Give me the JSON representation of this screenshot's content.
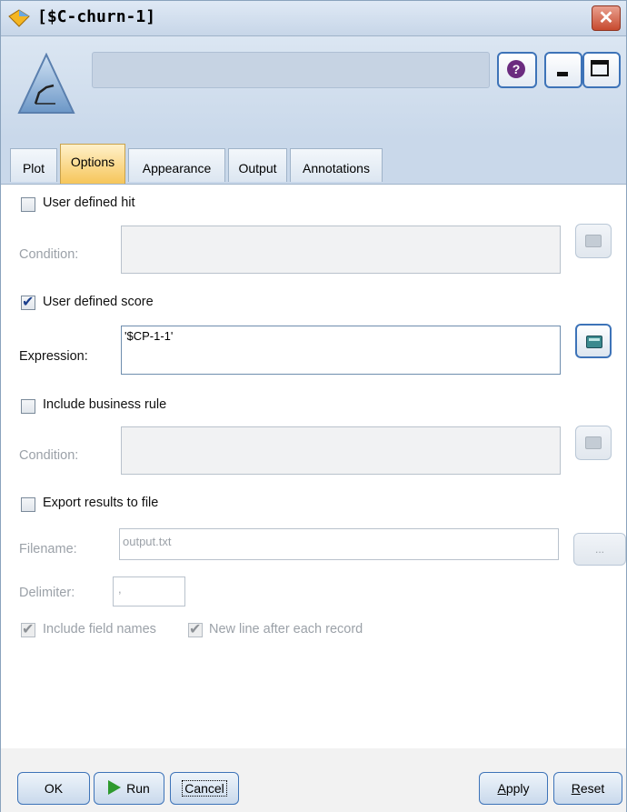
{
  "window": {
    "title": "[$C-churn-1]"
  },
  "header": {
    "node_name": ""
  },
  "tabs": [
    {
      "label": "Plot",
      "active": false
    },
    {
      "label": "Options",
      "active": true
    },
    {
      "label": "Appearance",
      "active": false
    },
    {
      "label": "Output",
      "active": false
    },
    {
      "label": "Annotations",
      "active": false
    }
  ],
  "options": {
    "user_defined_hit": {
      "label": "User defined hit",
      "checked": false,
      "condition_label": "Condition:",
      "condition_value": ""
    },
    "user_defined_score": {
      "label": "User defined score",
      "checked": true,
      "expression_label": "Expression:",
      "expression_value": "'$CP-1-1'"
    },
    "include_business_rule": {
      "label": "Include business rule",
      "checked": false,
      "condition_label": "Condition:",
      "condition_value": ""
    },
    "export_results": {
      "label": "Export results to file",
      "checked": false,
      "filename_label": "Filename:",
      "filename_value": "output.txt",
      "browse_label": "...",
      "delimiter_label": "Delimiter:",
      "delimiter_value": ",",
      "include_field_names": {
        "label": "Include field names",
        "checked": true
      },
      "new_line_after_record": {
        "label": "New line after each record",
        "checked": true
      }
    }
  },
  "footer": {
    "ok": "OK",
    "run": "Run",
    "cancel": "Cancel",
    "apply_u": "A",
    "apply_rest": "pply",
    "reset_u": "R",
    "reset_rest": "eset"
  },
  "colors": {
    "accent": "#3d73b8",
    "active_tab": "#f6c65a",
    "run_green": "#2e9a2e"
  }
}
